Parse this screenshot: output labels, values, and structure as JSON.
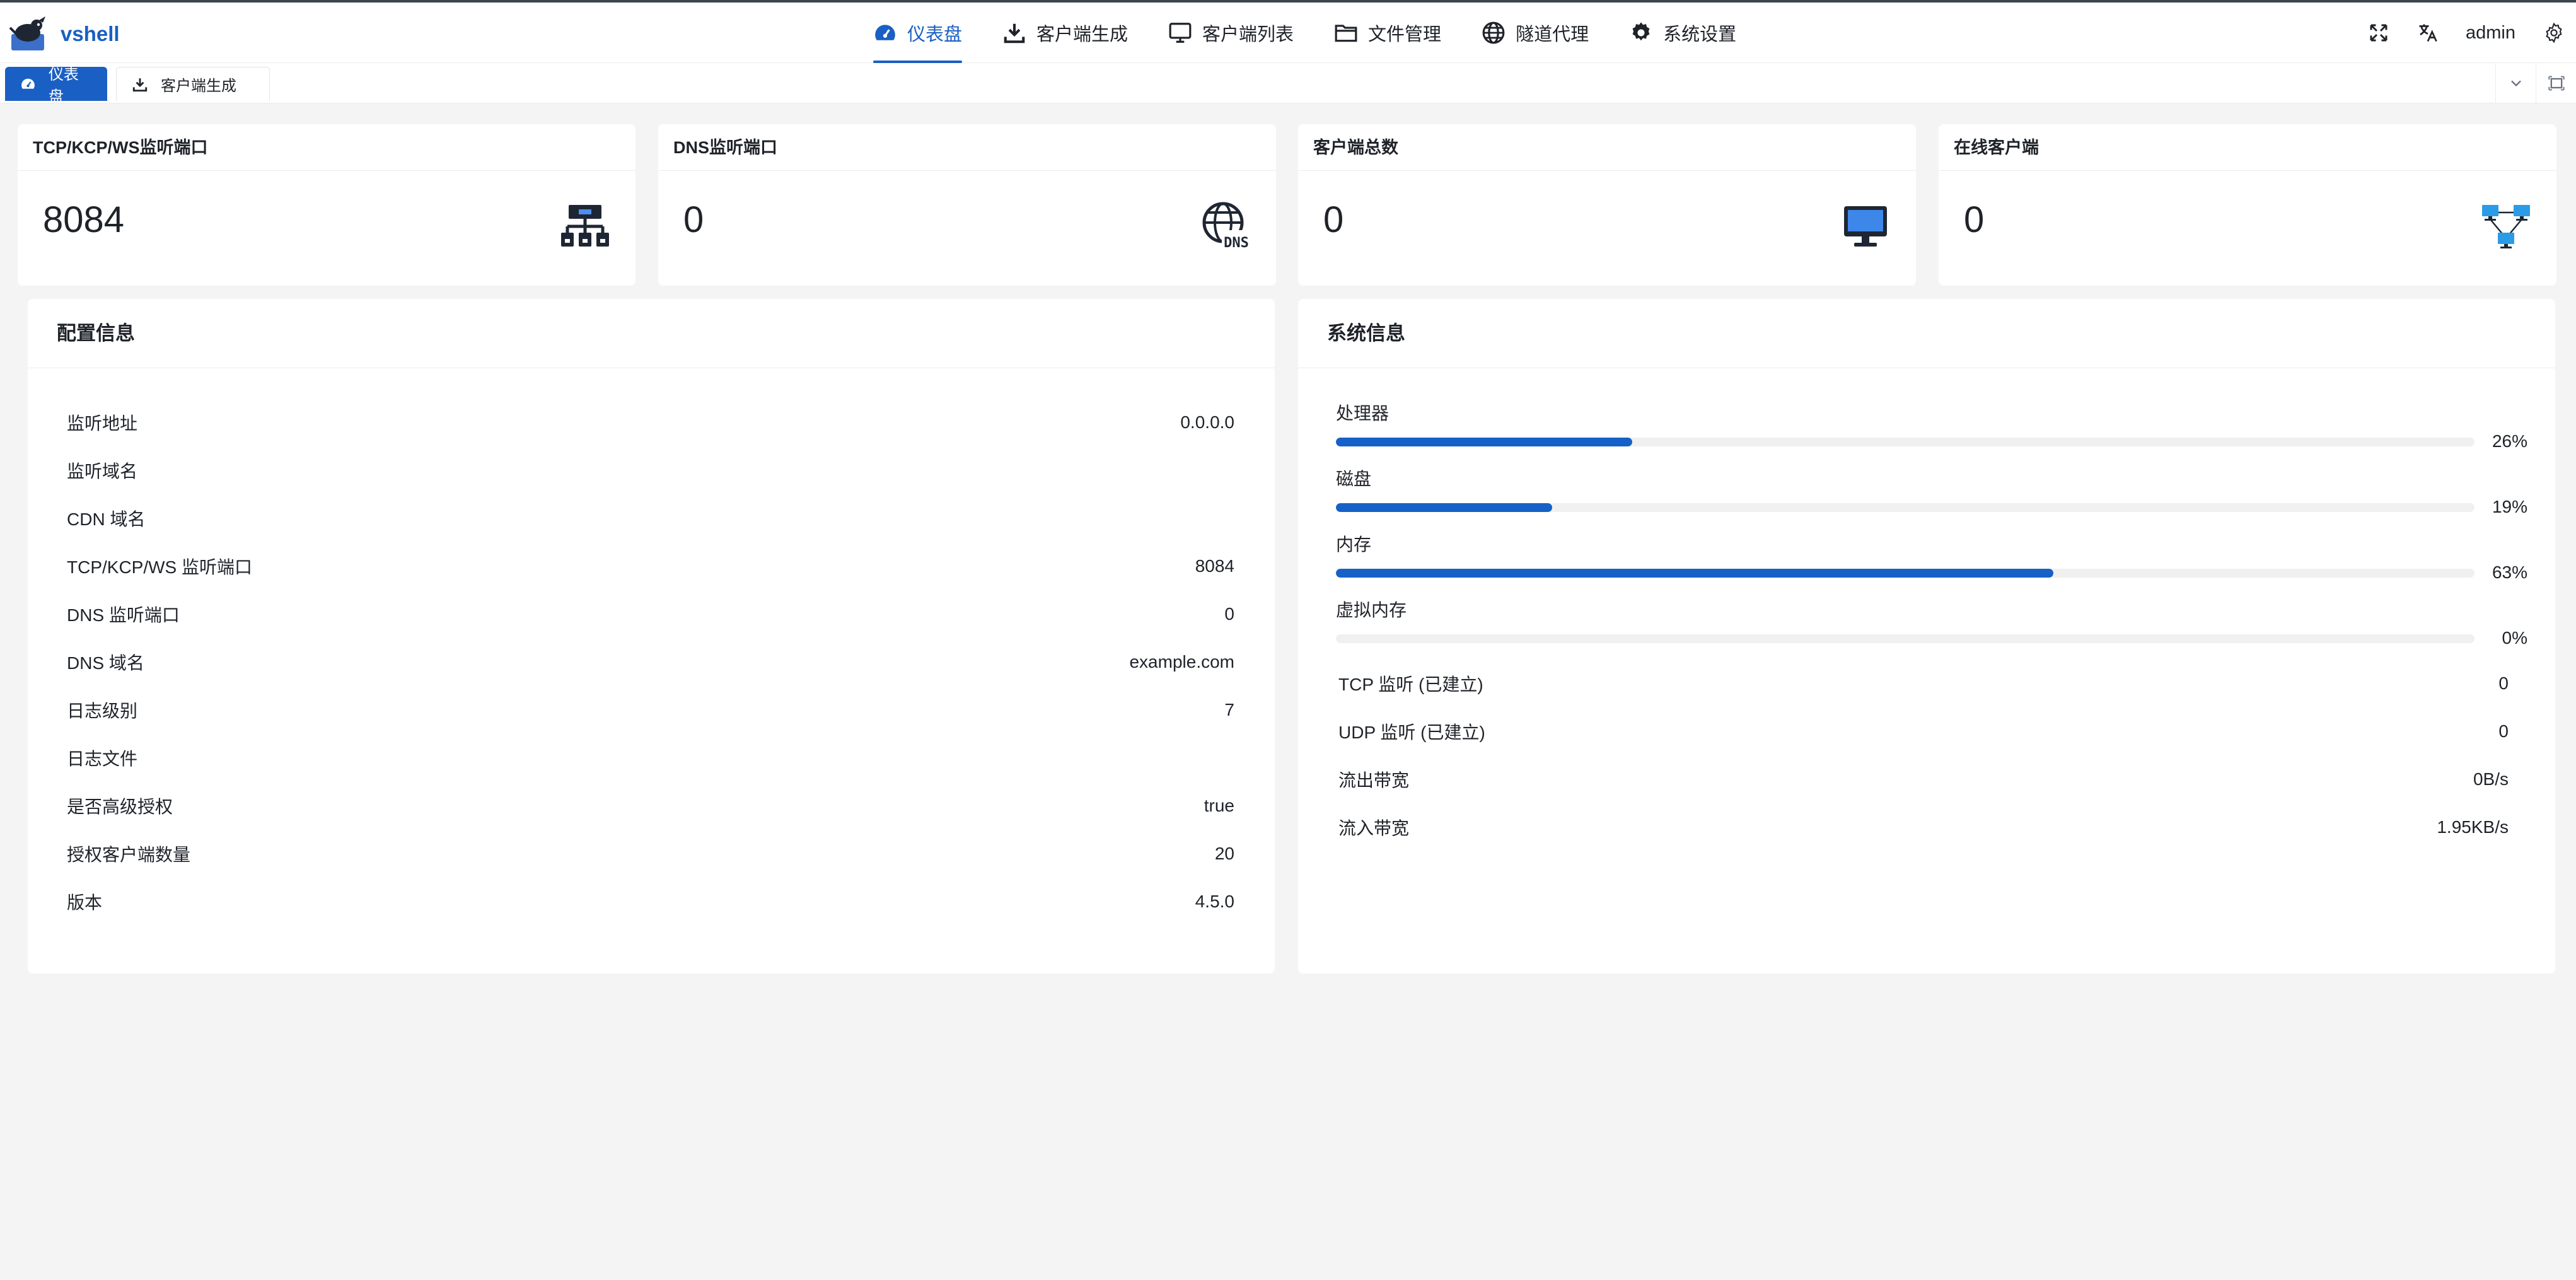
{
  "brand": {
    "name": "vshell"
  },
  "nav": {
    "items": [
      {
        "label": "仪表盘",
        "active": true
      },
      {
        "label": "客户端生成"
      },
      {
        "label": "客户端列表"
      },
      {
        "label": "文件管理"
      },
      {
        "label": "隧道代理"
      },
      {
        "label": "系统设置"
      }
    ],
    "user": "admin"
  },
  "tabs": [
    {
      "label": "仪表盘",
      "active": true
    },
    {
      "label": "客户端生成",
      "active": false
    }
  ],
  "stats": [
    {
      "title": "TCP/KCP/WS监听端口",
      "value": "8084",
      "icon": "network-hierarchy-icon"
    },
    {
      "title": "DNS监听端口",
      "value": "0",
      "icon": "dns-globe-icon"
    },
    {
      "title": "客户端总数",
      "value": "0",
      "icon": "monitor-icon"
    },
    {
      "title": "在线客户端",
      "value": "0",
      "icon": "connected-computers-icon"
    }
  ],
  "config": {
    "title": "配置信息",
    "rows": [
      {
        "key": "监听地址",
        "value": "0.0.0.0"
      },
      {
        "key": "监听域名",
        "value": ""
      },
      {
        "key": "CDN 域名",
        "value": ""
      },
      {
        "key": "TCP/KCP/WS 监听端口",
        "value": "8084"
      },
      {
        "key": "DNS 监听端口",
        "value": "0"
      },
      {
        "key": "DNS 域名",
        "value": "example.com"
      },
      {
        "key": "日志级别",
        "value": "7"
      },
      {
        "key": "日志文件",
        "value": ""
      },
      {
        "key": "是否高级授权",
        "value": "true"
      },
      {
        "key": "授权客户端数量",
        "value": "20"
      },
      {
        "key": "版本",
        "value": "4.5.0"
      }
    ]
  },
  "system": {
    "title": "系统信息",
    "progress": [
      {
        "label": "处理器",
        "percent": 26,
        "text": "26%"
      },
      {
        "label": "磁盘",
        "percent": 19,
        "text": "19%"
      },
      {
        "label": "内存",
        "percent": 63,
        "text": "63%"
      },
      {
        "label": "虚拟内存",
        "percent": 0,
        "text": "0%"
      }
    ],
    "rows": [
      {
        "key": "TCP 监听 (已建立)",
        "value": "0"
      },
      {
        "key": "UDP 监听 (已建立)",
        "value": "0"
      },
      {
        "key": "流出带宽",
        "value": "0B/s"
      },
      {
        "key": "流入带宽",
        "value": "1.95KB/s"
      }
    ]
  },
  "colors": {
    "accent": "#1a5fc4",
    "background": "#f4f4f5"
  }
}
